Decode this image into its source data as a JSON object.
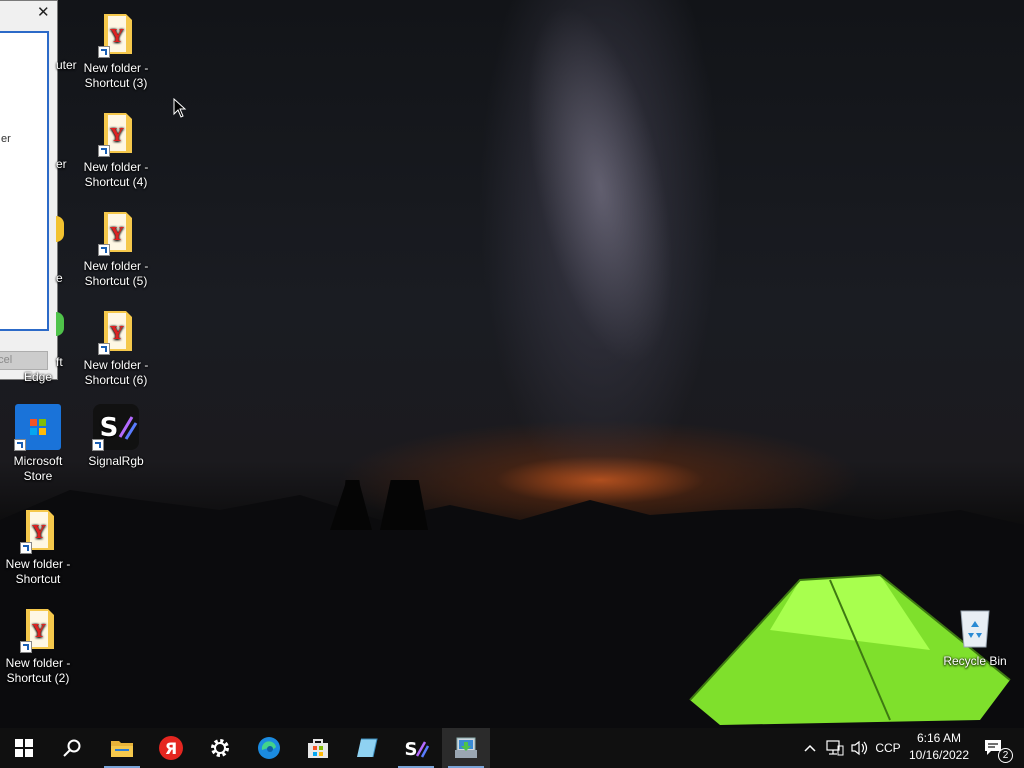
{
  "desktop": {
    "icons": [
      {
        "label": "New folder - Shortcut (3)"
      },
      {
        "label": "New folder - Shortcut (4)"
      },
      {
        "label": "New folder - Shortcut (5)"
      },
      {
        "label": "New folder - Shortcut (6)"
      },
      {
        "label": "Microsoft Store"
      },
      {
        "label": "SignalRgb"
      },
      {
        "label": "New folder - Shortcut"
      },
      {
        "label": "New folder - Shortcut (2)"
      },
      {
        "label": "Recycle Bin"
      }
    ],
    "partial_labels": [
      "uter",
      "er",
      "e",
      "ft",
      "Edge"
    ]
  },
  "dialog": {
    "close_glyph": "✕",
    "cancel_label": "ncel",
    "fragment": "er"
  },
  "taskbar": {
    "language": "CCP",
    "time": "6:16 AM",
    "date": "10/16/2022",
    "notification_count": "2",
    "search_glyph": "⚲",
    "tray_chevron": "^"
  },
  "colors": {
    "taskbar_bg": "#101010",
    "folder_yellow": "#f5c84c",
    "dialog_accent": "#2c6ac8",
    "tent_green": "#8cf23a"
  }
}
